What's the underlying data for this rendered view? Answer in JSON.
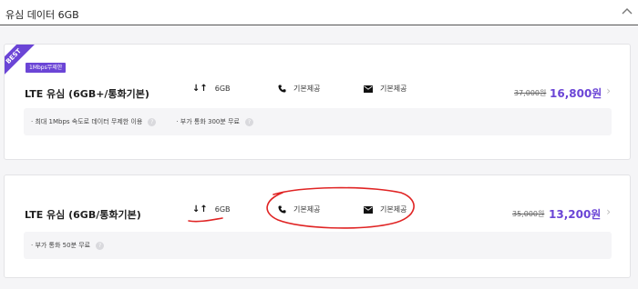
{
  "header": {
    "title": "유심 데이터 6GB"
  },
  "plans": [
    {
      "badge": "BEST",
      "promo": "1Mbps무제한",
      "name": "LTE 유심 (6GB+/통화기본)",
      "data": "6GB",
      "call": "기본제공",
      "msg": "기본제공",
      "old_price": "37,000원",
      "new_price": "16,800원",
      "info": [
        "· 최대 1Mbps 속도로 데이터 무제한 이용",
        "· 부가 통화 300분 무료"
      ]
    },
    {
      "name": "LTE 유심 (6GB/통화기본)",
      "data": "6GB",
      "call": "기본제공",
      "msg": "기본제공",
      "old_price": "35,000원",
      "new_price": "13,200원",
      "info": [
        "· 부가 통화 50분 무료"
      ]
    }
  ],
  "colors": {
    "accent": "#6b45d6",
    "annotation": "#e02424"
  }
}
